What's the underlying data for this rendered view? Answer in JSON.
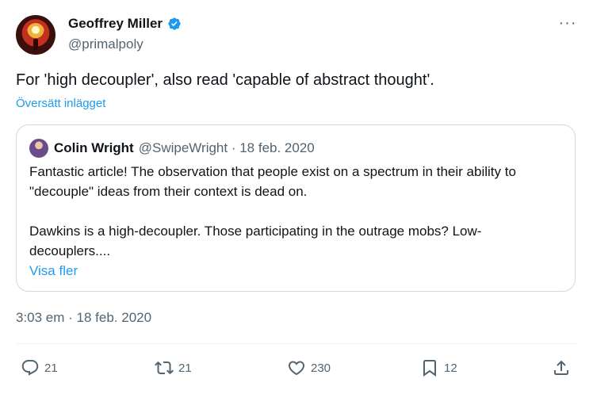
{
  "author": {
    "name": "Geoffrey Miller",
    "handle": "@primalpoly",
    "avatar_icon": "avatar-icon",
    "verified_icon": "verified-badge-icon"
  },
  "tweet": {
    "text": "For 'high decoupler', also read 'capable of abstract thought'.",
    "translate_label": "Översätt inlägget",
    "timestamp": "3:03 em · 18 feb. 2020"
  },
  "quote": {
    "name": "Colin Wright",
    "meta": "@SwipeWright · 18 feb. 2020",
    "paragraph1": "Fantastic article! The observation that people exist on a spectrum in their ability to \"decouple\" ideas from their context is dead on.",
    "paragraph2": "Dawkins is a high-decoupler. Those participating in the outrage mobs? Low-decouplers....",
    "show_more": "Visa fler"
  },
  "actions": {
    "replies": "21",
    "reposts": "21",
    "likes": "230",
    "bookmarks": "12"
  },
  "colors": {
    "accent": "#1d9bf0",
    "text": "#0f1419",
    "secondary": "#536471",
    "border": "#cfd9de"
  }
}
